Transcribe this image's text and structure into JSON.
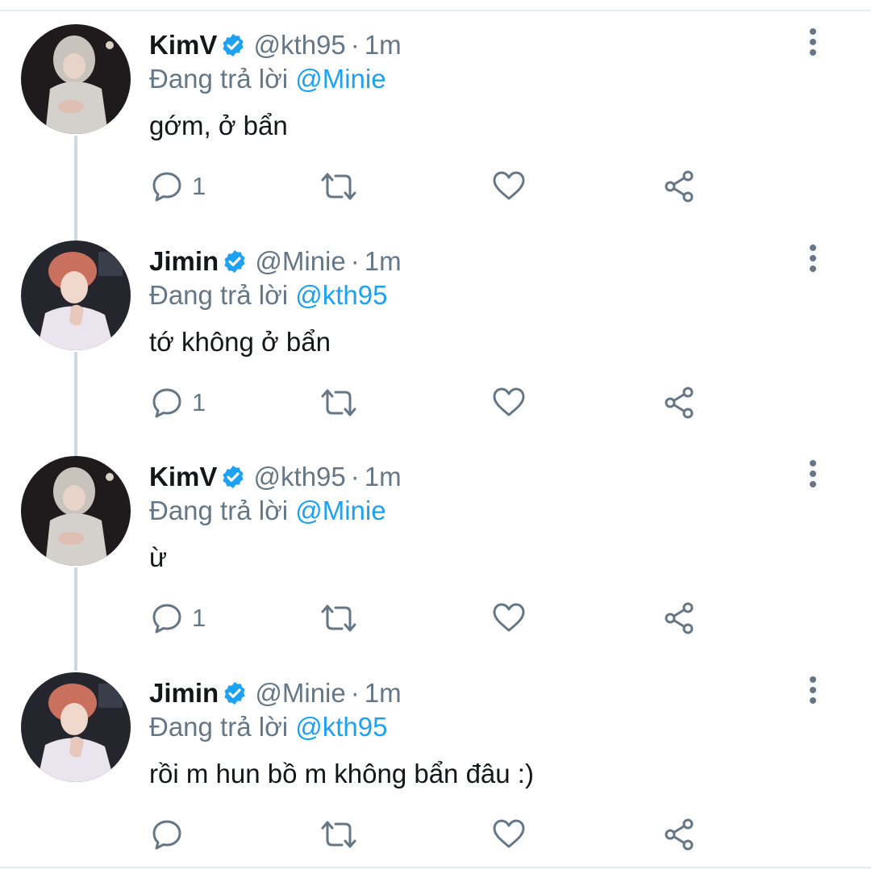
{
  "thread": [
    {
      "author": {
        "name": "KimV",
        "handle": "@kth95",
        "verified": true,
        "avatar": "avatar-hooded-person"
      },
      "time": "1m",
      "reply_prefix": "Đang trả lời",
      "reply_to": "@Minie",
      "text": "gớm, ở bẩn",
      "reply_count": "1"
    },
    {
      "author": {
        "name": "Jimin",
        "handle": "@Minie",
        "verified": true,
        "avatar": "avatar-red-hair-person"
      },
      "time": "1m",
      "reply_prefix": "Đang trả lời",
      "reply_to": "@kth95",
      "text": "tớ không ở bẩn",
      "reply_count": "1"
    },
    {
      "author": {
        "name": "KimV",
        "handle": "@kth95",
        "verified": true,
        "avatar": "avatar-hooded-person"
      },
      "time": "1m",
      "reply_prefix": "Đang trả lời",
      "reply_to": "@Minie",
      "text": "ừ",
      "reply_count": "1"
    },
    {
      "author": {
        "name": "Jimin",
        "handle": "@Minie",
        "verified": true,
        "avatar": "avatar-red-hair-person"
      },
      "time": "1m",
      "reply_prefix": "Đang trả lời",
      "reply_to": "@kth95",
      "text": "rồi m hun bồ m không bẩn đâu :)",
      "reply_count": ""
    }
  ],
  "separator": "·",
  "icons": [
    "reply-icon",
    "retweet-icon",
    "like-icon",
    "share-icon",
    "more-vertical-icon",
    "verified-badge-icon"
  ],
  "colors": {
    "accent": "#1da1f2",
    "muted": "#657786",
    "text": "#14171a",
    "thread_line": "#cfd9de"
  }
}
